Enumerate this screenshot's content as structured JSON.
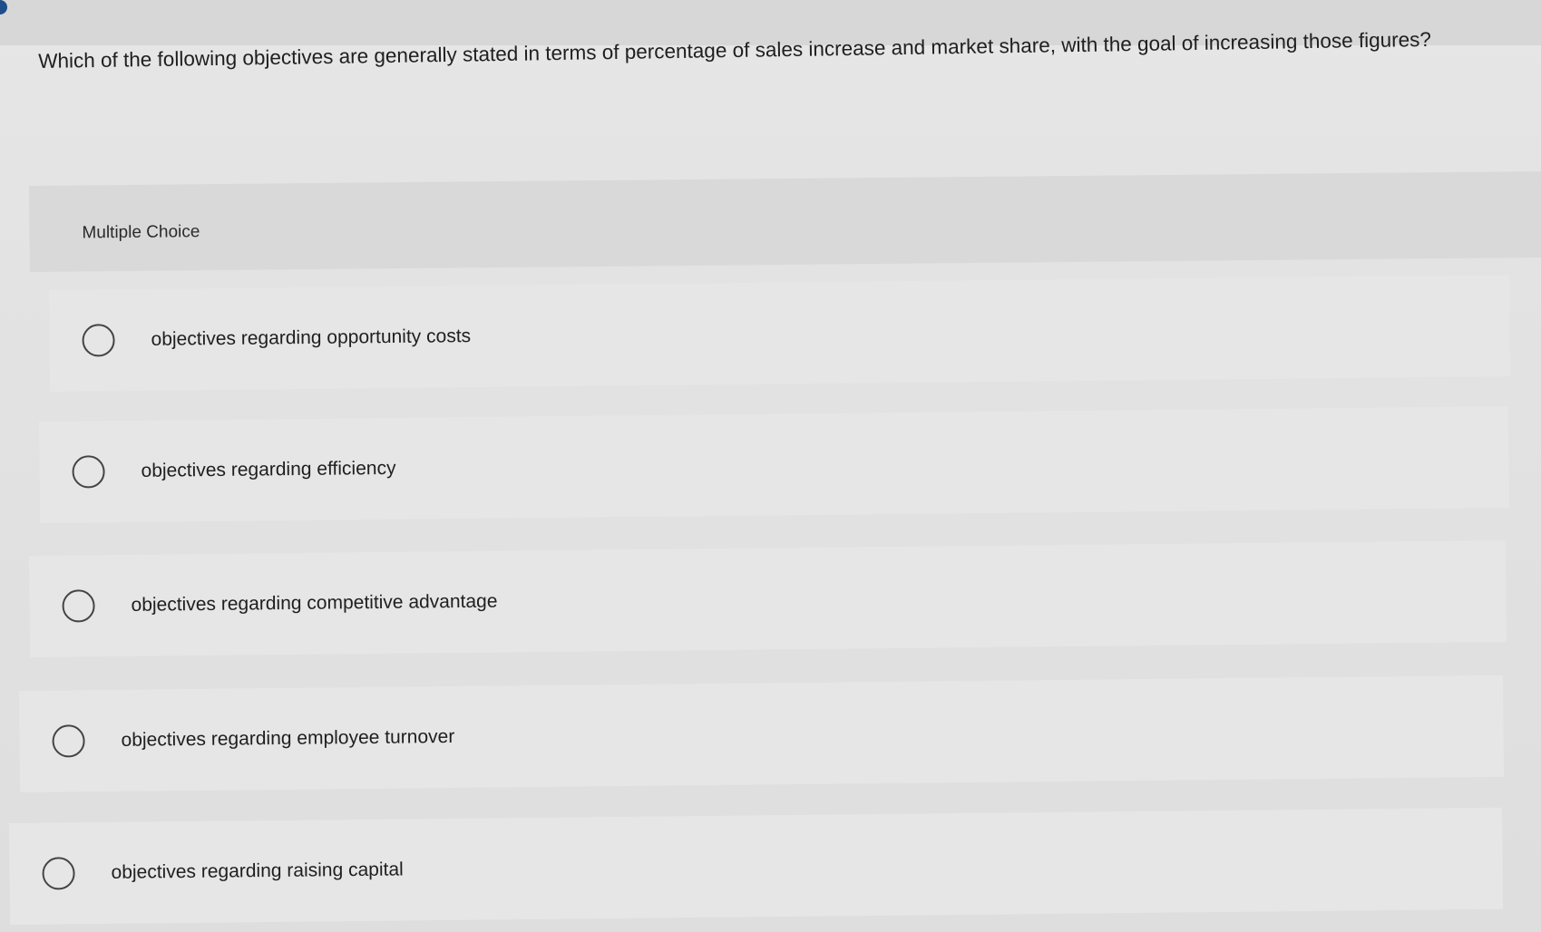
{
  "question": {
    "text": "Which of the following objectives are generally stated in terms of percentage of sales increase and market share, with the goal of increasing those figures?"
  },
  "multiple_choice": {
    "label": "Multiple Choice"
  },
  "options": [
    {
      "text": "objectives regarding opportunity costs"
    },
    {
      "text": "objectives regarding efficiency"
    },
    {
      "text": "objectives regarding competitive advantage"
    },
    {
      "text": "objectives regarding employee turnover"
    },
    {
      "text": "objectives regarding raising capital"
    }
  ],
  "colors": {
    "background": "#e2e2e2",
    "option_background": "#e6e6e6",
    "header_background": "#d9d9d9",
    "accent": "#1d4e8a",
    "text": "#1f1f1f"
  }
}
